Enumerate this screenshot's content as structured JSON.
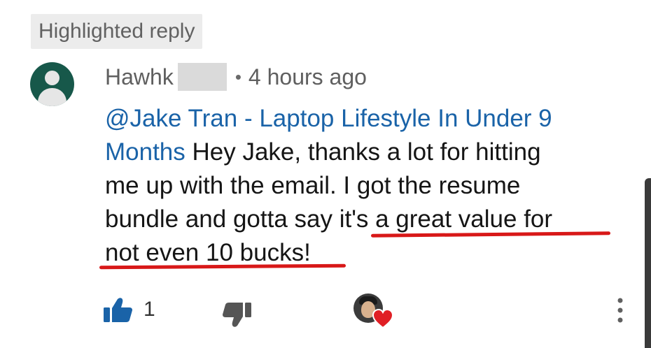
{
  "badge": {
    "label": "Highlighted reply"
  },
  "comment": {
    "author": "Hawhk",
    "separator": "•",
    "time": "4 hours ago",
    "lines": [
      {
        "mention": "@Jake Tran - Laptop Lifestyle In Under 9",
        "text": ""
      },
      {
        "mention": "Months",
        "text": " Hey Jake, thanks a lot for hitting"
      },
      {
        "mention": "",
        "text": "me up with the email. I got the resume"
      },
      {
        "mention": "",
        "text": "bundle and gotta say it's a great value for"
      },
      {
        "mention": "",
        "text": "not even 10 bucks!"
      }
    ]
  },
  "actions": {
    "like_count": "1",
    "like_icon": "thumbs-up-icon",
    "dislike_icon": "thumbs-down-icon",
    "creator_heart_icon": "heart-icon",
    "more_icon": "more-vertical-icon"
  },
  "colors": {
    "mention": "#1a63a8",
    "like_active": "#1a63a8",
    "heart": "#e01f25",
    "underline_annotation": "#d81818",
    "avatar_bg": "#17584a"
  }
}
